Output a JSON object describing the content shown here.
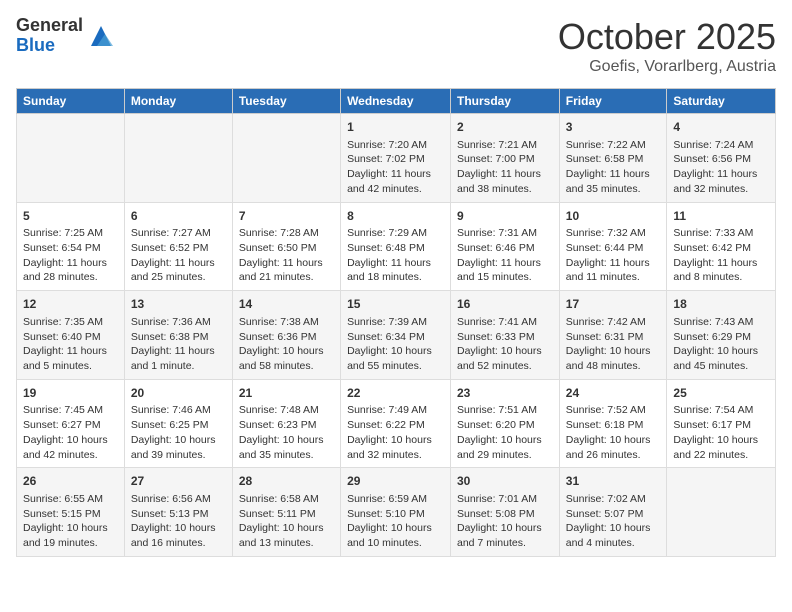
{
  "header": {
    "logo_general": "General",
    "logo_blue": "Blue",
    "month_title": "October 2025",
    "subtitle": "Goefis, Vorarlberg, Austria"
  },
  "days_of_week": [
    "Sunday",
    "Monday",
    "Tuesday",
    "Wednesday",
    "Thursday",
    "Friday",
    "Saturday"
  ],
  "weeks": [
    [
      {
        "day": "",
        "info": ""
      },
      {
        "day": "",
        "info": ""
      },
      {
        "day": "",
        "info": ""
      },
      {
        "day": "1",
        "info": "Sunrise: 7:20 AM\nSunset: 7:02 PM\nDaylight: 11 hours\nand 42 minutes."
      },
      {
        "day": "2",
        "info": "Sunrise: 7:21 AM\nSunset: 7:00 PM\nDaylight: 11 hours\nand 38 minutes."
      },
      {
        "day": "3",
        "info": "Sunrise: 7:22 AM\nSunset: 6:58 PM\nDaylight: 11 hours\nand 35 minutes."
      },
      {
        "day": "4",
        "info": "Sunrise: 7:24 AM\nSunset: 6:56 PM\nDaylight: 11 hours\nand 32 minutes."
      }
    ],
    [
      {
        "day": "5",
        "info": "Sunrise: 7:25 AM\nSunset: 6:54 PM\nDaylight: 11 hours\nand 28 minutes."
      },
      {
        "day": "6",
        "info": "Sunrise: 7:27 AM\nSunset: 6:52 PM\nDaylight: 11 hours\nand 25 minutes."
      },
      {
        "day": "7",
        "info": "Sunrise: 7:28 AM\nSunset: 6:50 PM\nDaylight: 11 hours\nand 21 minutes."
      },
      {
        "day": "8",
        "info": "Sunrise: 7:29 AM\nSunset: 6:48 PM\nDaylight: 11 hours\nand 18 minutes."
      },
      {
        "day": "9",
        "info": "Sunrise: 7:31 AM\nSunset: 6:46 PM\nDaylight: 11 hours\nand 15 minutes."
      },
      {
        "day": "10",
        "info": "Sunrise: 7:32 AM\nSunset: 6:44 PM\nDaylight: 11 hours\nand 11 minutes."
      },
      {
        "day": "11",
        "info": "Sunrise: 7:33 AM\nSunset: 6:42 PM\nDaylight: 11 hours\nand 8 minutes."
      }
    ],
    [
      {
        "day": "12",
        "info": "Sunrise: 7:35 AM\nSunset: 6:40 PM\nDaylight: 11 hours\nand 5 minutes."
      },
      {
        "day": "13",
        "info": "Sunrise: 7:36 AM\nSunset: 6:38 PM\nDaylight: 11 hours\nand 1 minute."
      },
      {
        "day": "14",
        "info": "Sunrise: 7:38 AM\nSunset: 6:36 PM\nDaylight: 10 hours\nand 58 minutes."
      },
      {
        "day": "15",
        "info": "Sunrise: 7:39 AM\nSunset: 6:34 PM\nDaylight: 10 hours\nand 55 minutes."
      },
      {
        "day": "16",
        "info": "Sunrise: 7:41 AM\nSunset: 6:33 PM\nDaylight: 10 hours\nand 52 minutes."
      },
      {
        "day": "17",
        "info": "Sunrise: 7:42 AM\nSunset: 6:31 PM\nDaylight: 10 hours\nand 48 minutes."
      },
      {
        "day": "18",
        "info": "Sunrise: 7:43 AM\nSunset: 6:29 PM\nDaylight: 10 hours\nand 45 minutes."
      }
    ],
    [
      {
        "day": "19",
        "info": "Sunrise: 7:45 AM\nSunset: 6:27 PM\nDaylight: 10 hours\nand 42 minutes."
      },
      {
        "day": "20",
        "info": "Sunrise: 7:46 AM\nSunset: 6:25 PM\nDaylight: 10 hours\nand 39 minutes."
      },
      {
        "day": "21",
        "info": "Sunrise: 7:48 AM\nSunset: 6:23 PM\nDaylight: 10 hours\nand 35 minutes."
      },
      {
        "day": "22",
        "info": "Sunrise: 7:49 AM\nSunset: 6:22 PM\nDaylight: 10 hours\nand 32 minutes."
      },
      {
        "day": "23",
        "info": "Sunrise: 7:51 AM\nSunset: 6:20 PM\nDaylight: 10 hours\nand 29 minutes."
      },
      {
        "day": "24",
        "info": "Sunrise: 7:52 AM\nSunset: 6:18 PM\nDaylight: 10 hours\nand 26 minutes."
      },
      {
        "day": "25",
        "info": "Sunrise: 7:54 AM\nSunset: 6:17 PM\nDaylight: 10 hours\nand 22 minutes."
      }
    ],
    [
      {
        "day": "26",
        "info": "Sunrise: 6:55 AM\nSunset: 5:15 PM\nDaylight: 10 hours\nand 19 minutes."
      },
      {
        "day": "27",
        "info": "Sunrise: 6:56 AM\nSunset: 5:13 PM\nDaylight: 10 hours\nand 16 minutes."
      },
      {
        "day": "28",
        "info": "Sunrise: 6:58 AM\nSunset: 5:11 PM\nDaylight: 10 hours\nand 13 minutes."
      },
      {
        "day": "29",
        "info": "Sunrise: 6:59 AM\nSunset: 5:10 PM\nDaylight: 10 hours\nand 10 minutes."
      },
      {
        "day": "30",
        "info": "Sunrise: 7:01 AM\nSunset: 5:08 PM\nDaylight: 10 hours\nand 7 minutes."
      },
      {
        "day": "31",
        "info": "Sunrise: 7:02 AM\nSunset: 5:07 PM\nDaylight: 10 hours\nand 4 minutes."
      },
      {
        "day": "",
        "info": ""
      }
    ]
  ]
}
